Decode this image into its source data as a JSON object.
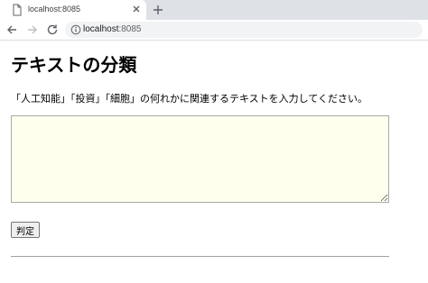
{
  "browser": {
    "tab_title": "localhost:8085",
    "url_host": "localhost",
    "url_port": ":8085"
  },
  "page": {
    "title": "テキストの分類",
    "instruction": "「人工知能」「投資」「細胞」の何れかに関連するテキストを入力してください。",
    "textarea_value": "",
    "textarea_bg": "#ffffee",
    "submit_label": "判定"
  }
}
